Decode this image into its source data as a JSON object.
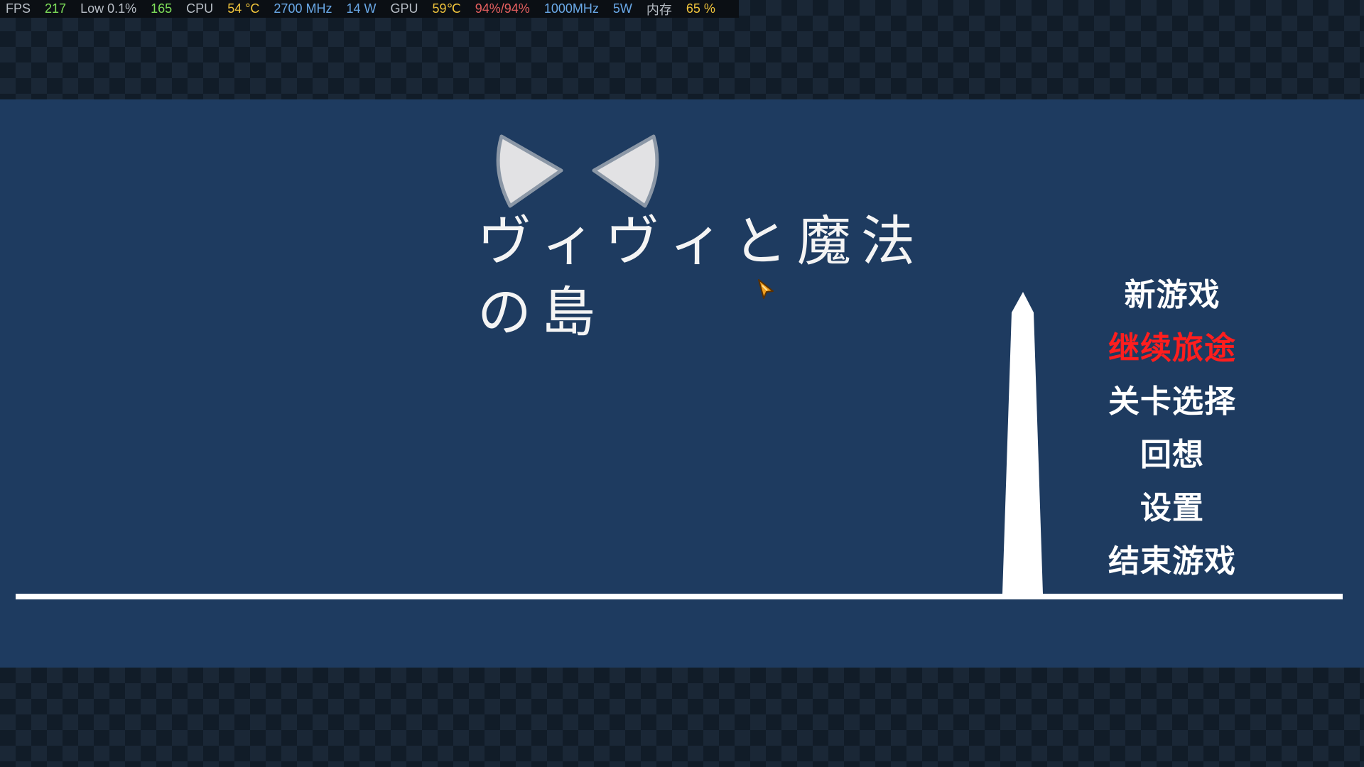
{
  "overlay": {
    "fps_label": "FPS",
    "fps_value": "217",
    "low_label": "Low 0.1%",
    "low_value": "165",
    "cpu_label": "CPU",
    "cpu_temp": "54 °C",
    "cpu_clock": "2700 MHz",
    "cpu_power": "14 W",
    "gpu_label": "GPU",
    "gpu_temp": "59℃",
    "gpu_usage": "94%/94%",
    "gpu_clock": "1000MHz",
    "gpu_power": "5W",
    "mem_label": "内存",
    "mem_value": "65 %"
  },
  "game": {
    "title": "ヴィヴィと魔法の島"
  },
  "menu": {
    "items": [
      {
        "label": "新游戏",
        "active": false
      },
      {
        "label": "继续旅途",
        "active": true
      },
      {
        "label": "关卡选择",
        "active": false
      },
      {
        "label": "回想",
        "active": false
      },
      {
        "label": "设置",
        "active": false
      },
      {
        "label": "结束游戏",
        "active": false
      }
    ]
  },
  "colors": {
    "panel": "#1e3b60",
    "menu_text": "#ffffff",
    "menu_selected": "#ff1e1e"
  }
}
